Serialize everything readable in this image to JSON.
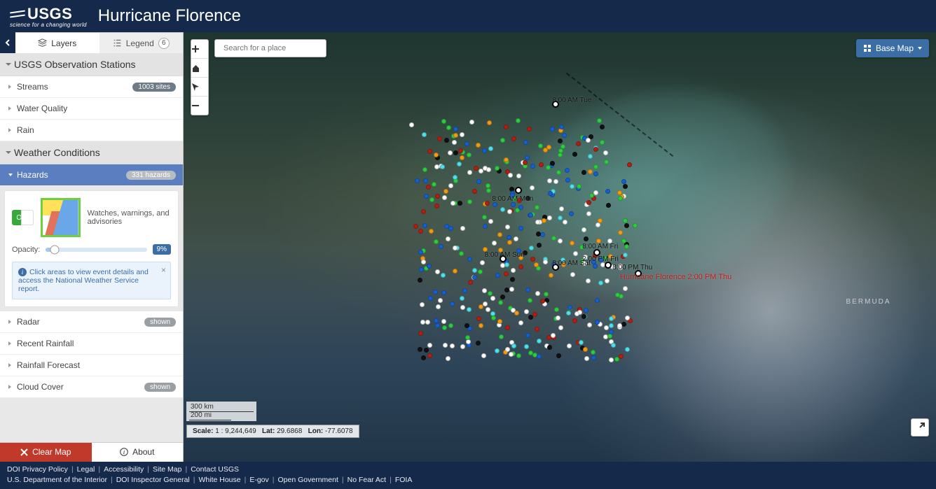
{
  "header": {
    "org": "USGS",
    "tagline": "science for a changing world",
    "title": "Hurricane Florence"
  },
  "tabs": {
    "layers": "Layers",
    "legend": "Legend",
    "legend_count": "6"
  },
  "sections": {
    "observation": {
      "title": "USGS Observation Stations",
      "streams": {
        "label": "Streams",
        "badge": "1003 sites"
      },
      "water_quality": {
        "label": "Water Quality"
      },
      "rain": {
        "label": "Rain"
      }
    },
    "weather": {
      "title": "Weather Conditions",
      "hazards": {
        "label": "Hazards",
        "badge": "331 hazards"
      },
      "radar": {
        "label": "Radar",
        "badge": "shown"
      },
      "recent_rainfall": {
        "label": "Recent Rainfall"
      },
      "rainfall_forecast": {
        "label": "Rainfall Forecast"
      },
      "cloud_cover": {
        "label": "Cloud Cover",
        "badge": "shown"
      }
    }
  },
  "hazard_panel": {
    "toggle": "On",
    "desc": "Watches, warnings, and advisories",
    "opacity_label": "Opacity:",
    "opacity_value": "9%",
    "info": "Click areas to view event details and access the National Weather Service report."
  },
  "bottom": {
    "clear": "Clear Map",
    "about": "About"
  },
  "map": {
    "search_placeholder": "Search for a place",
    "basemap": "Base Map",
    "scale_km": "300 km",
    "scale_mi": "200 mi",
    "coords": {
      "scale_label": "Scale:",
      "scale": "1 : 9,244,649",
      "lat_label": "Lat:",
      "lat": "29.6868",
      "lon_label": "Lon:",
      "lon": "-77.6078"
    },
    "bermuda": "BERMUDA",
    "timestamps": {
      "tue": "8:00 AM Tue",
      "mon": "8:00 AM Mon",
      "sun": "8:00 AM Sun",
      "sat": "8:00 AM Sat",
      "fri": "8:00 AM Fri",
      "fri2": "2:00 PM Fri",
      "thu": "8:00 PM Thu",
      "storm": "Hurricane Florence 2:00 PM Thu"
    }
  },
  "footer": {
    "row1": [
      "DOI Privacy Policy",
      "Legal",
      "Accessibility",
      "Site Map",
      "Contact USGS"
    ],
    "row2": [
      "U.S. Department of the Interior",
      "DOI Inspector General",
      "White House",
      "E-gov",
      "Open Government",
      "No Fear Act",
      "FOIA"
    ]
  }
}
